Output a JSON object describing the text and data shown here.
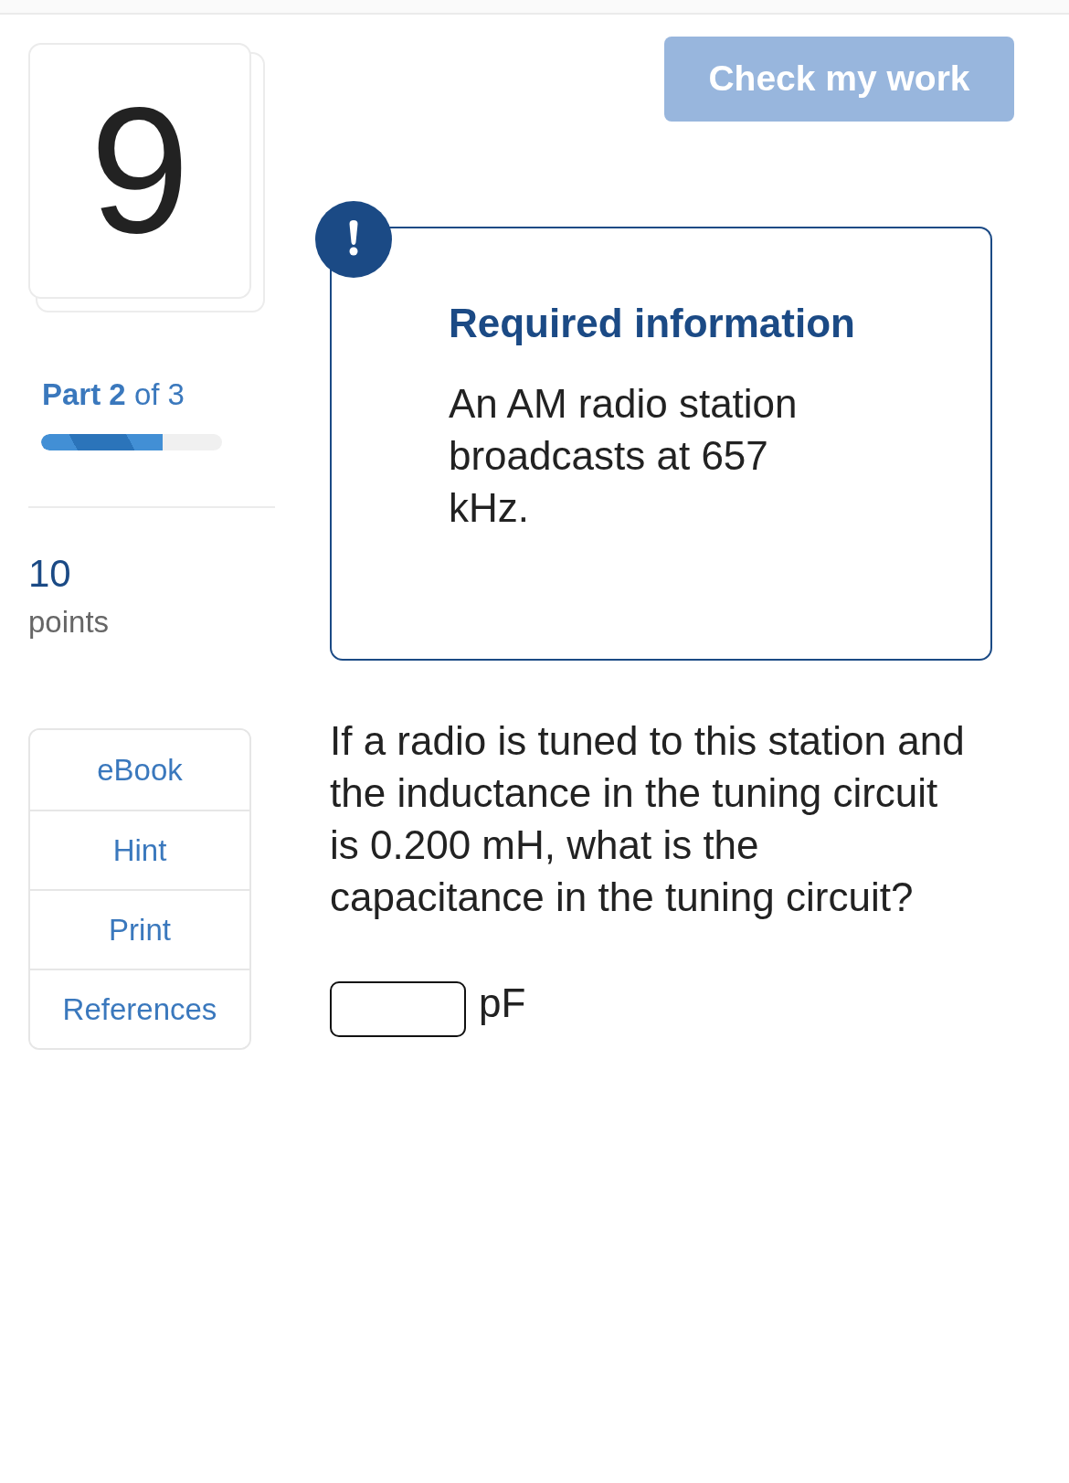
{
  "question_card": {
    "number": "9",
    "part": "**Part 2** of 3",
    "progress": {
      "level": 0.67
    },
    "points_value": "10",
    "points_label": "points"
  },
  "check_button": {
    "label": "Check my work",
    "disabled": true
  },
  "sidebar": {
    "items": [
      {
        "label": "eBook"
      },
      {
        "label": "Hint"
      },
      {
        "label": "Print"
      },
      {
        "label": "References"
      }
    ]
  },
  "required_info": {
    "title": "Required information",
    "text": "An AM radio station broadcasts at 657 kHz."
  },
  "prompt": "If a radio is tuned to this station and the inductance in the tuning circuit is 0.200 mH, what is the capacitance in the tuning circuit?",
  "answer": {
    "unit": "pF"
  }
}
